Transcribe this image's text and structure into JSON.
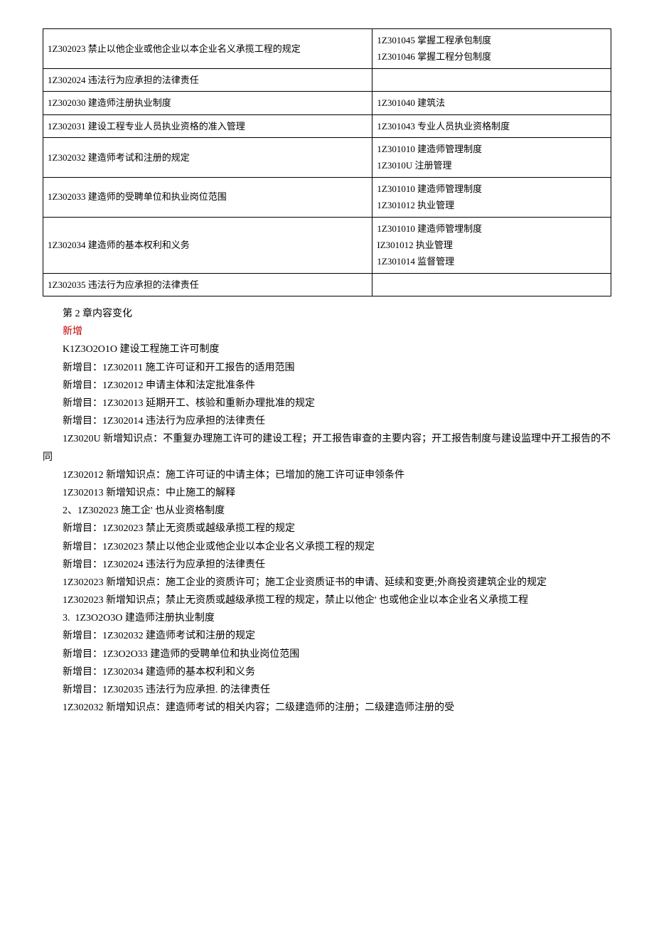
{
  "table": {
    "rows": [
      {
        "left": "1Z302023 禁止以他企业或他企业以本企业名义承揽工程的规定",
        "right": "1Z301045 掌握工程承包制度\n1Z301046 掌握工程分包制度"
      },
      {
        "left": "1Z302024 违法行为应承担的法律责任",
        "right": ""
      },
      {
        "left": "1Z302030 建造师注册执业制度",
        "right": "1Z301040 建筑法"
      },
      {
        "left": "1Z302031 建设工程专业人员执业资格的准入管理",
        "right": "1Z301043 专业人员执业资格制度"
      },
      {
        "left": "1Z302032 建造师考试和注册的规定",
        "right": "1Z301010 建造师管理制度\n1Z3010U 注册管理"
      },
      {
        "left": "1Z302033 建造师的受聘单位和执业岗位范围",
        "right": "1Z301010 建造师管理制度\n1Z301012 执业管理"
      },
      {
        "left": "1Z302034 建造师的基本权利和义务",
        "right": "1Z301010 建造师管埋制度\nIZ301012 执业管理\n1Z301014 监督管理"
      },
      {
        "left": "1Z302035 违法行为应承担的法律责任",
        "right": ""
      }
    ]
  },
  "body": {
    "heading1": "第 2 章内容变化",
    "heading2": "新增",
    "p1": "K1Z3O2O1O 建设工程施工许可制度",
    "p2": "新增目：1Z302011 施工许可证和开工报告的适用范围",
    "p3": "新增目：1Z302012 申请主体和法定批准条件",
    "p4": "新增目：1Z302013 延期开工、核验和重新办理批准的规定",
    "p5": "新增目：1Z302014 违法行为应承担的法律责任",
    "p6": "1Z3020U 新增知识点：不重复办理施工许可的建设工程；开工报告审查的主要内容；开工报告制度与建设监理中开工报告的不同",
    "p7": "1Z302012 新增知识点：施工许可证的中请主体；已增加的施工许可证申领条件",
    "p8": "1Z302013 新增知识点：中止施工的解释",
    "p9": "2、1Z302023 施工企' 也从业资格制度",
    "p10": "新增目：1Z302023 禁止无资质或越级承揽工程的规定",
    "p11": "新增目：1Z302023 禁止以他企业或他企业以本企业名义承揽工程的规定",
    "p12": "新增目：1Z302024 违法行为应承担的法律责任",
    "p13": "1Z302023 新增知识点：施工企业的资质许可；施工企业资质证书的申请、延续和变更;外商投资建筑企业的规定",
    "p14": "1Z302023 新增知识点；禁止无资质或越级承揽工程的规定，禁止以他企' 也或他企业以本企业名义承揽工程",
    "p15": "3.  1Z3O2O3O 建造师注册执业制度",
    "p16": "新增目：1Z302032 建造师考试和注册的规定",
    "p17": "新增目：1Z3O2O33 建造师的受聘单位和执业岗位范围",
    "p18": "新增目：1Z302034 建造师的基本权利和义务",
    "p19": "新增目：1Z302035 违法行为应承担. 的法律责任",
    "p20": "1Z302032 新增知识点：建造师考试的相关内容；二级建造师的注册；二级建造师注册的受"
  }
}
